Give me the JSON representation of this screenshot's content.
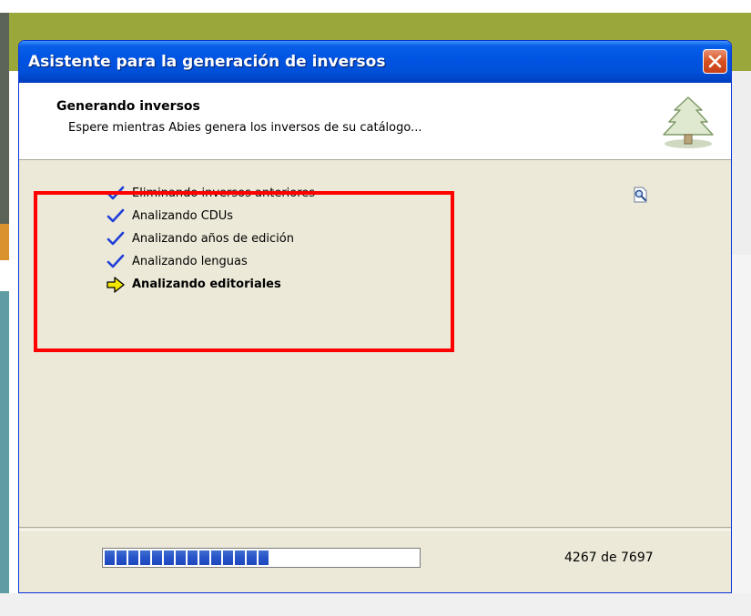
{
  "window": {
    "title": "Asistente para la generación de inversos"
  },
  "header": {
    "title": "Generando inversos",
    "subtitle": "Espere mientras Abies genera los inversos de su catálogo..."
  },
  "steps": [
    {
      "label": "Eliminando inversos anteriores",
      "status": "done"
    },
    {
      "label": "Analizando CDUs",
      "status": "done"
    },
    {
      "label": "Analizando años de edición",
      "status": "done"
    },
    {
      "label": "Analizando lenguas",
      "status": "done"
    },
    {
      "label": "Analizando editoriales",
      "status": "current"
    }
  ],
  "progress": {
    "current": 4267,
    "total": 7697,
    "text": "4267 de 7697"
  },
  "icons": {
    "close": "close-icon",
    "logo": "tree-icon",
    "done": "check-icon",
    "current": "arrow-right-icon",
    "search": "magnifier-icon"
  },
  "colors": {
    "title_bar": "#0054e3",
    "check": "#1f3fd8",
    "arrow": "#f5e800",
    "progress": "#2853c9",
    "highlight": "#ff0000"
  }
}
